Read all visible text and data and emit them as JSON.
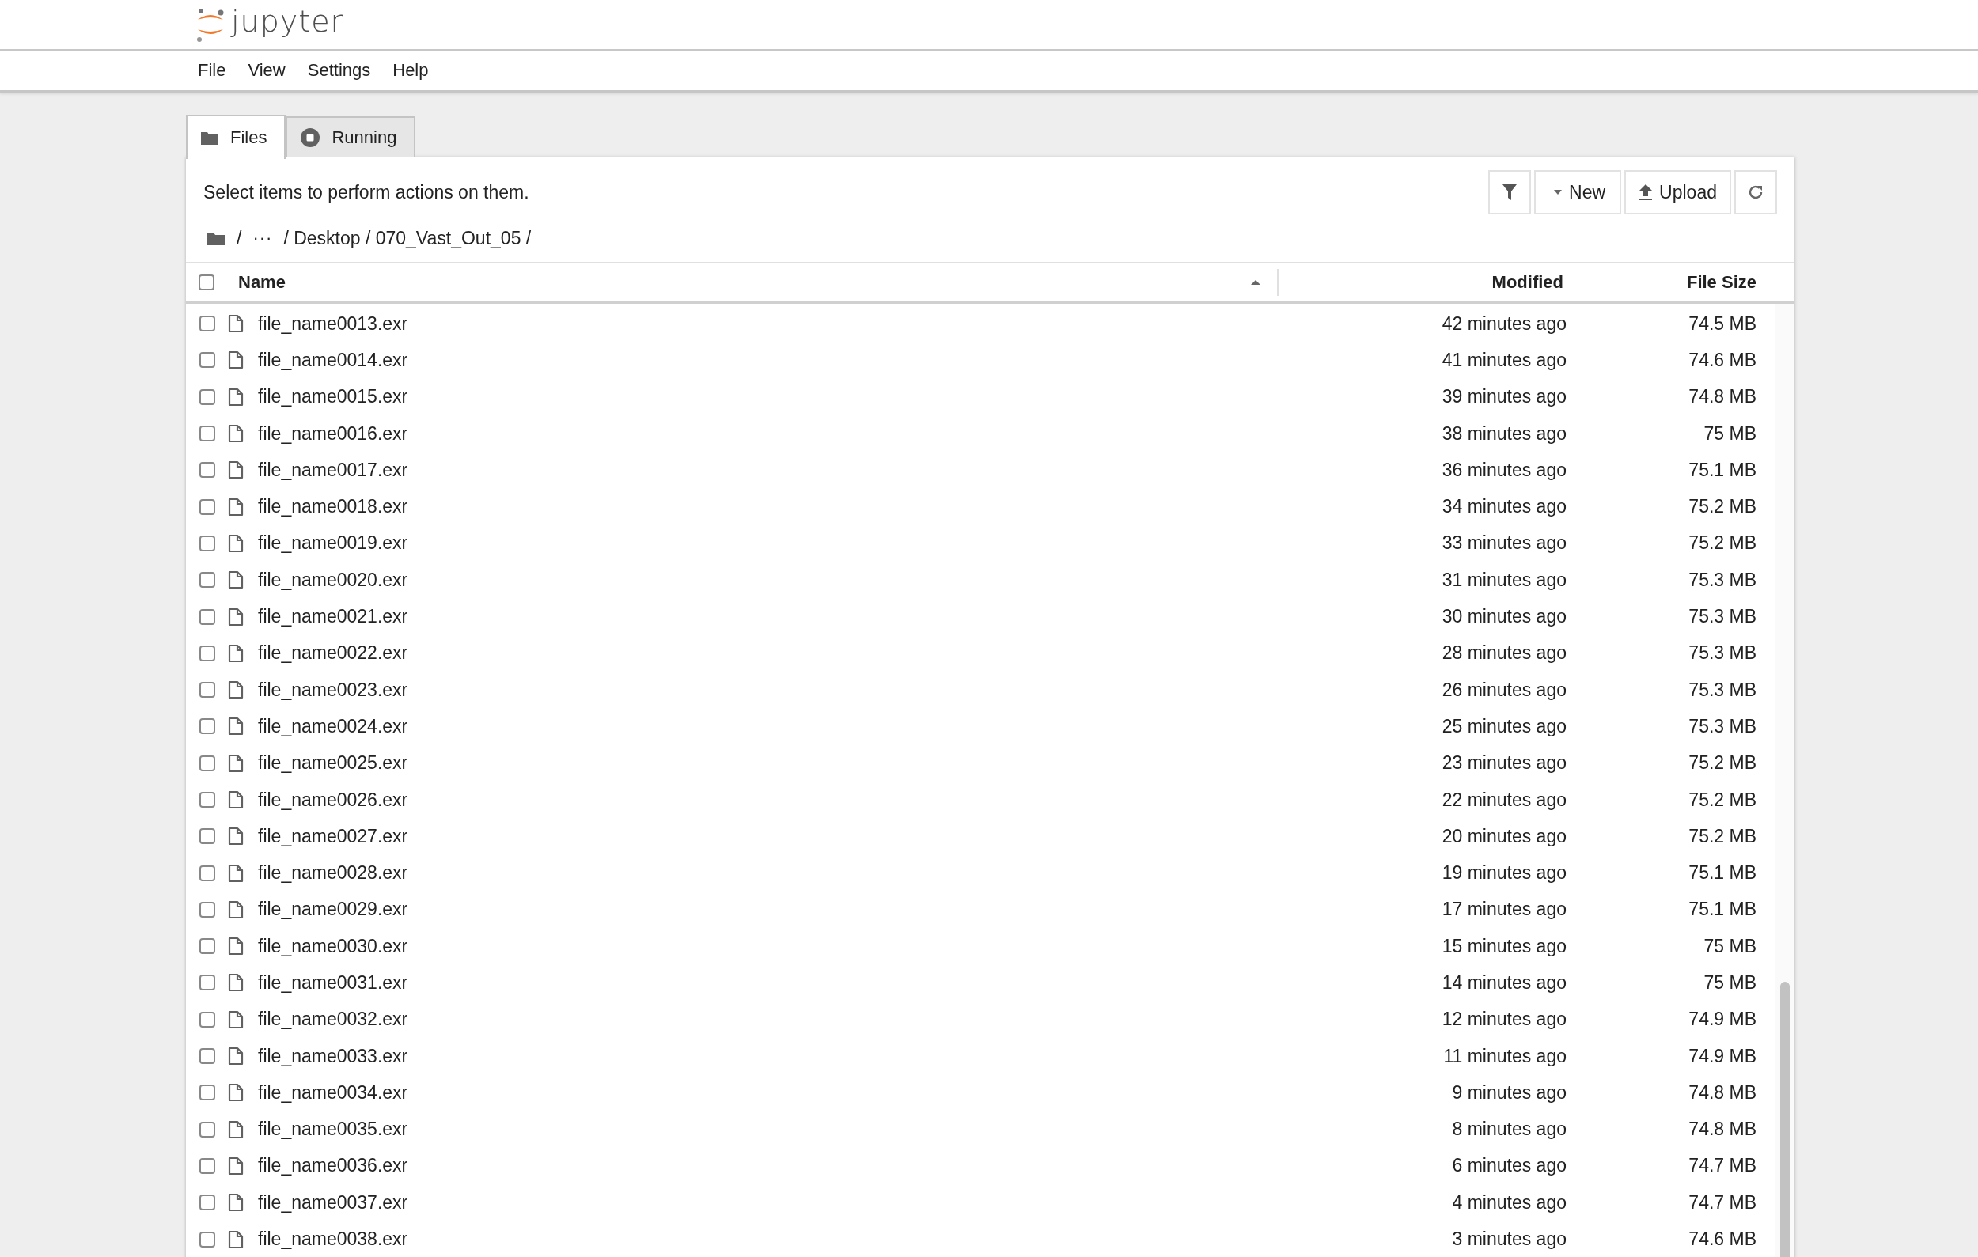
{
  "header": {
    "logo_text": "jupyter"
  },
  "menu": [
    "File",
    "View",
    "Settings",
    "Help"
  ],
  "tabs": [
    {
      "label": "Files",
      "kind": "files",
      "selected": true
    },
    {
      "label": "Running",
      "kind": "running",
      "selected": false
    }
  ],
  "toolbar": {
    "hint": "Select items to perform actions on them.",
    "buttons": [
      {
        "kind": "filter"
      },
      {
        "kind": "new",
        "label": "New"
      },
      {
        "kind": "upload",
        "label": "Upload"
      },
      {
        "kind": "refresh"
      }
    ]
  },
  "breadcrumb": [
    "/",
    "···",
    "/ Desktop / 070_Vast_Out_05 /"
  ],
  "table": {
    "select_all": {
      "checked": false
    },
    "columns": [
      {
        "label": "Name",
        "sorted": true
      },
      {
        "label": "Modified",
        "sorted": false
      },
      {
        "label": "File Size",
        "sorted": false
      }
    ],
    "rows": [
      {
        "name": "file_name0013.exr",
        "modified": "42 minutes ago",
        "size": "74.5 MB",
        "checked": false
      },
      {
        "name": "file_name0014.exr",
        "modified": "41 minutes ago",
        "size": "74.6 MB",
        "checked": false
      },
      {
        "name": "file_name0015.exr",
        "modified": "39 minutes ago",
        "size": "74.8 MB",
        "checked": false
      },
      {
        "name": "file_name0016.exr",
        "modified": "38 minutes ago",
        "size": "75 MB",
        "checked": false
      },
      {
        "name": "file_name0017.exr",
        "modified": "36 minutes ago",
        "size": "75.1 MB",
        "checked": false
      },
      {
        "name": "file_name0018.exr",
        "modified": "34 minutes ago",
        "size": "75.2 MB",
        "checked": false
      },
      {
        "name": "file_name0019.exr",
        "modified": "33 minutes ago",
        "size": "75.2 MB",
        "checked": false
      },
      {
        "name": "file_name0020.exr",
        "modified": "31 minutes ago",
        "size": "75.3 MB",
        "checked": false
      },
      {
        "name": "file_name0021.exr",
        "modified": "30 minutes ago",
        "size": "75.3 MB",
        "checked": false
      },
      {
        "name": "file_name0022.exr",
        "modified": "28 minutes ago",
        "size": "75.3 MB",
        "checked": false
      },
      {
        "name": "file_name0023.exr",
        "modified": "26 minutes ago",
        "size": "75.3 MB",
        "checked": false
      },
      {
        "name": "file_name0024.exr",
        "modified": "25 minutes ago",
        "size": "75.3 MB",
        "checked": false
      },
      {
        "name": "file_name0025.exr",
        "modified": "23 minutes ago",
        "size": "75.2 MB",
        "checked": false
      },
      {
        "name": "file_name0026.exr",
        "modified": "22 minutes ago",
        "size": "75.2 MB",
        "checked": false
      },
      {
        "name": "file_name0027.exr",
        "modified": "20 minutes ago",
        "size": "75.2 MB",
        "checked": false
      },
      {
        "name": "file_name0028.exr",
        "modified": "19 minutes ago",
        "size": "75.1 MB",
        "checked": false
      },
      {
        "name": "file_name0029.exr",
        "modified": "17 minutes ago",
        "size": "75.1 MB",
        "checked": false
      },
      {
        "name": "file_name0030.exr",
        "modified": "15 minutes ago",
        "size": "75 MB",
        "checked": false
      },
      {
        "name": "file_name0031.exr",
        "modified": "14 minutes ago",
        "size": "75 MB",
        "checked": false
      },
      {
        "name": "file_name0032.exr",
        "modified": "12 minutes ago",
        "size": "74.9 MB",
        "checked": false
      },
      {
        "name": "file_name0033.exr",
        "modified": "11 minutes ago",
        "size": "74.9 MB",
        "checked": false
      },
      {
        "name": "file_name0034.exr",
        "modified": "9 minutes ago",
        "size": "74.8 MB",
        "checked": false
      },
      {
        "name": "file_name0035.exr",
        "modified": "8 minutes ago",
        "size": "74.8 MB",
        "checked": false
      },
      {
        "name": "file_name0036.exr",
        "modified": "6 minutes ago",
        "size": "74.7 MB",
        "checked": false
      },
      {
        "name": "file_name0037.exr",
        "modified": "4 minutes ago",
        "size": "74.7 MB",
        "checked": false
      },
      {
        "name": "file_name0038.exr",
        "modified": "3 minutes ago",
        "size": "74.6 MB",
        "checked": false
      }
    ]
  }
}
